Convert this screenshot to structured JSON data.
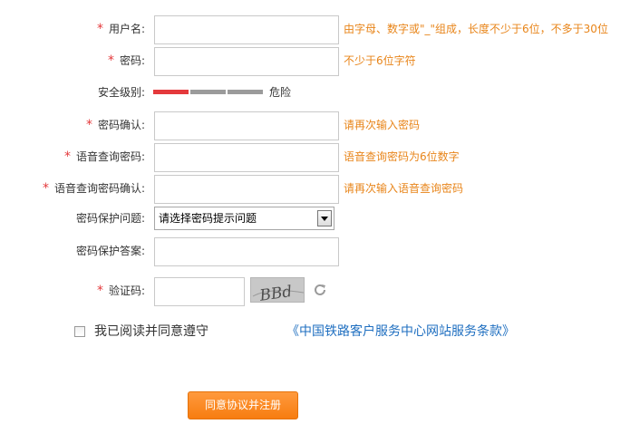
{
  "fields": {
    "username": {
      "star": "*",
      "label": "用户名:",
      "value": "",
      "hint": "由字母、数字或\"_\"组成，长度不少于6位，不多于30位"
    },
    "password": {
      "star": "*",
      "label": "密码:",
      "value": "",
      "hint": "不少于6位字符"
    },
    "strength": {
      "label": "安全级别:",
      "level_text": "危险",
      "level": 1,
      "segments": 3,
      "colors": {
        "active": "#e4393c",
        "inactive": "#9b9b9b"
      }
    },
    "password_confirm": {
      "star": "*",
      "label": "密码确认:",
      "value": "",
      "hint": "请再次输入密码"
    },
    "voice_password": {
      "star": "*",
      "label": "语音查询密码:",
      "value": "",
      "hint": "语音查询密码为6位数字"
    },
    "voice_password_confirm": {
      "star": "*",
      "label": "语音查询密码确认:",
      "value": "",
      "hint": "请再次输入语音查询密码"
    },
    "security_question": {
      "label": "密码保护问题:",
      "selected": "请选择密码提示问题"
    },
    "security_answer": {
      "label": "密码保护答案:",
      "value": ""
    },
    "captcha": {
      "star": "*",
      "label": "验证码:",
      "value": "",
      "image_text": "BBd",
      "refresh_icon": "refresh-icon"
    }
  },
  "agreement": {
    "checked": false,
    "text": "我已阅读并同意遵守",
    "link": "《中国铁路客户服务中心网站服务条款》"
  },
  "submit": {
    "label": "同意协议并注册"
  },
  "colors": {
    "hint": "#e8851a",
    "required": "#e4393c",
    "link": "#1f6fc0",
    "button": "#f7861c"
  }
}
